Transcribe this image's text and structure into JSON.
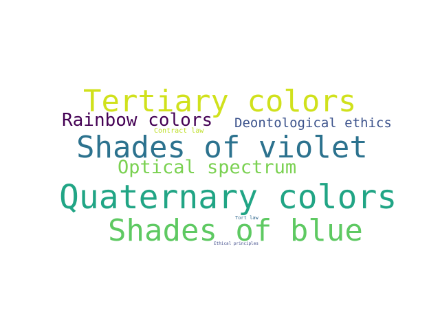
{
  "words": [
    {
      "text": "Tertiary colors",
      "color": "#d0e11c"
    },
    {
      "text": "Rainbow colors",
      "color": "#440154"
    },
    {
      "text": "Deontological ethics",
      "color": "#3b528b"
    },
    {
      "text": "Contract law",
      "color": "#bddf26"
    },
    {
      "text": "Shades of violet",
      "color": "#2c728e"
    },
    {
      "text": "Optical spectrum",
      "color": "#7ad151"
    },
    {
      "text": "Quaternary colors",
      "color": "#21a585"
    },
    {
      "text": "Tort law",
      "color": "#31688e"
    },
    {
      "text": "Shades of blue",
      "color": "#5ec962"
    },
    {
      "text": "Ethical principles",
      "color": "#3e4a89"
    }
  ]
}
